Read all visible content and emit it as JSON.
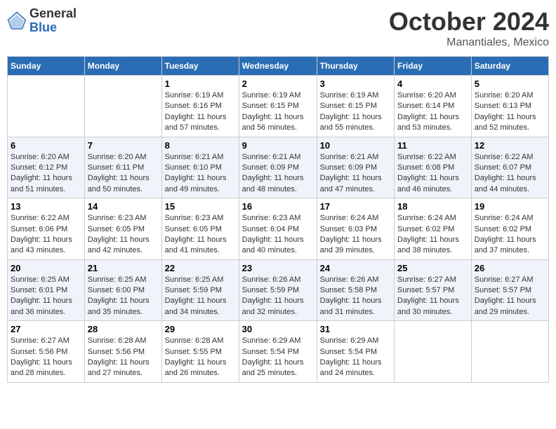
{
  "logo": {
    "general": "General",
    "blue": "Blue"
  },
  "title": "October 2024",
  "location": "Manantiales, Mexico",
  "days_header": [
    "Sunday",
    "Monday",
    "Tuesday",
    "Wednesday",
    "Thursday",
    "Friday",
    "Saturday"
  ],
  "weeks": [
    [
      {
        "day": "",
        "sunrise": "",
        "sunset": "",
        "daylight": ""
      },
      {
        "day": "",
        "sunrise": "",
        "sunset": "",
        "daylight": ""
      },
      {
        "day": "1",
        "sunrise": "Sunrise: 6:19 AM",
        "sunset": "Sunset: 6:16 PM",
        "daylight": "Daylight: 11 hours and 57 minutes."
      },
      {
        "day": "2",
        "sunrise": "Sunrise: 6:19 AM",
        "sunset": "Sunset: 6:15 PM",
        "daylight": "Daylight: 11 hours and 56 minutes."
      },
      {
        "day": "3",
        "sunrise": "Sunrise: 6:19 AM",
        "sunset": "Sunset: 6:15 PM",
        "daylight": "Daylight: 11 hours and 55 minutes."
      },
      {
        "day": "4",
        "sunrise": "Sunrise: 6:20 AM",
        "sunset": "Sunset: 6:14 PM",
        "daylight": "Daylight: 11 hours and 53 minutes."
      },
      {
        "day": "5",
        "sunrise": "Sunrise: 6:20 AM",
        "sunset": "Sunset: 6:13 PM",
        "daylight": "Daylight: 11 hours and 52 minutes."
      }
    ],
    [
      {
        "day": "6",
        "sunrise": "Sunrise: 6:20 AM",
        "sunset": "Sunset: 6:12 PM",
        "daylight": "Daylight: 11 hours and 51 minutes."
      },
      {
        "day": "7",
        "sunrise": "Sunrise: 6:20 AM",
        "sunset": "Sunset: 6:11 PM",
        "daylight": "Daylight: 11 hours and 50 minutes."
      },
      {
        "day": "8",
        "sunrise": "Sunrise: 6:21 AM",
        "sunset": "Sunset: 6:10 PM",
        "daylight": "Daylight: 11 hours and 49 minutes."
      },
      {
        "day": "9",
        "sunrise": "Sunrise: 6:21 AM",
        "sunset": "Sunset: 6:09 PM",
        "daylight": "Daylight: 11 hours and 48 minutes."
      },
      {
        "day": "10",
        "sunrise": "Sunrise: 6:21 AM",
        "sunset": "Sunset: 6:09 PM",
        "daylight": "Daylight: 11 hours and 47 minutes."
      },
      {
        "day": "11",
        "sunrise": "Sunrise: 6:22 AM",
        "sunset": "Sunset: 6:08 PM",
        "daylight": "Daylight: 11 hours and 46 minutes."
      },
      {
        "day": "12",
        "sunrise": "Sunrise: 6:22 AM",
        "sunset": "Sunset: 6:07 PM",
        "daylight": "Daylight: 11 hours and 44 minutes."
      }
    ],
    [
      {
        "day": "13",
        "sunrise": "Sunrise: 6:22 AM",
        "sunset": "Sunset: 6:06 PM",
        "daylight": "Daylight: 11 hours and 43 minutes."
      },
      {
        "day": "14",
        "sunrise": "Sunrise: 6:23 AM",
        "sunset": "Sunset: 6:05 PM",
        "daylight": "Daylight: 11 hours and 42 minutes."
      },
      {
        "day": "15",
        "sunrise": "Sunrise: 6:23 AM",
        "sunset": "Sunset: 6:05 PM",
        "daylight": "Daylight: 11 hours and 41 minutes."
      },
      {
        "day": "16",
        "sunrise": "Sunrise: 6:23 AM",
        "sunset": "Sunset: 6:04 PM",
        "daylight": "Daylight: 11 hours and 40 minutes."
      },
      {
        "day": "17",
        "sunrise": "Sunrise: 6:24 AM",
        "sunset": "Sunset: 6:03 PM",
        "daylight": "Daylight: 11 hours and 39 minutes."
      },
      {
        "day": "18",
        "sunrise": "Sunrise: 6:24 AM",
        "sunset": "Sunset: 6:02 PM",
        "daylight": "Daylight: 11 hours and 38 minutes."
      },
      {
        "day": "19",
        "sunrise": "Sunrise: 6:24 AM",
        "sunset": "Sunset: 6:02 PM",
        "daylight": "Daylight: 11 hours and 37 minutes."
      }
    ],
    [
      {
        "day": "20",
        "sunrise": "Sunrise: 6:25 AM",
        "sunset": "Sunset: 6:01 PM",
        "daylight": "Daylight: 11 hours and 36 minutes."
      },
      {
        "day": "21",
        "sunrise": "Sunrise: 6:25 AM",
        "sunset": "Sunset: 6:00 PM",
        "daylight": "Daylight: 11 hours and 35 minutes."
      },
      {
        "day": "22",
        "sunrise": "Sunrise: 6:25 AM",
        "sunset": "Sunset: 5:59 PM",
        "daylight": "Daylight: 11 hours and 34 minutes."
      },
      {
        "day": "23",
        "sunrise": "Sunrise: 6:26 AM",
        "sunset": "Sunset: 5:59 PM",
        "daylight": "Daylight: 11 hours and 32 minutes."
      },
      {
        "day": "24",
        "sunrise": "Sunrise: 6:26 AM",
        "sunset": "Sunset: 5:58 PM",
        "daylight": "Daylight: 11 hours and 31 minutes."
      },
      {
        "day": "25",
        "sunrise": "Sunrise: 6:27 AM",
        "sunset": "Sunset: 5:57 PM",
        "daylight": "Daylight: 11 hours and 30 minutes."
      },
      {
        "day": "26",
        "sunrise": "Sunrise: 6:27 AM",
        "sunset": "Sunset: 5:57 PM",
        "daylight": "Daylight: 11 hours and 29 minutes."
      }
    ],
    [
      {
        "day": "27",
        "sunrise": "Sunrise: 6:27 AM",
        "sunset": "Sunset: 5:56 PM",
        "daylight": "Daylight: 11 hours and 28 minutes."
      },
      {
        "day": "28",
        "sunrise": "Sunrise: 6:28 AM",
        "sunset": "Sunset: 5:56 PM",
        "daylight": "Daylight: 11 hours and 27 minutes."
      },
      {
        "day": "29",
        "sunrise": "Sunrise: 6:28 AM",
        "sunset": "Sunset: 5:55 PM",
        "daylight": "Daylight: 11 hours and 26 minutes."
      },
      {
        "day": "30",
        "sunrise": "Sunrise: 6:29 AM",
        "sunset": "Sunset: 5:54 PM",
        "daylight": "Daylight: 11 hours and 25 minutes."
      },
      {
        "day": "31",
        "sunrise": "Sunrise: 6:29 AM",
        "sunset": "Sunset: 5:54 PM",
        "daylight": "Daylight: 11 hours and 24 minutes."
      },
      {
        "day": "",
        "sunrise": "",
        "sunset": "",
        "daylight": ""
      },
      {
        "day": "",
        "sunrise": "",
        "sunset": "",
        "daylight": ""
      }
    ]
  ]
}
